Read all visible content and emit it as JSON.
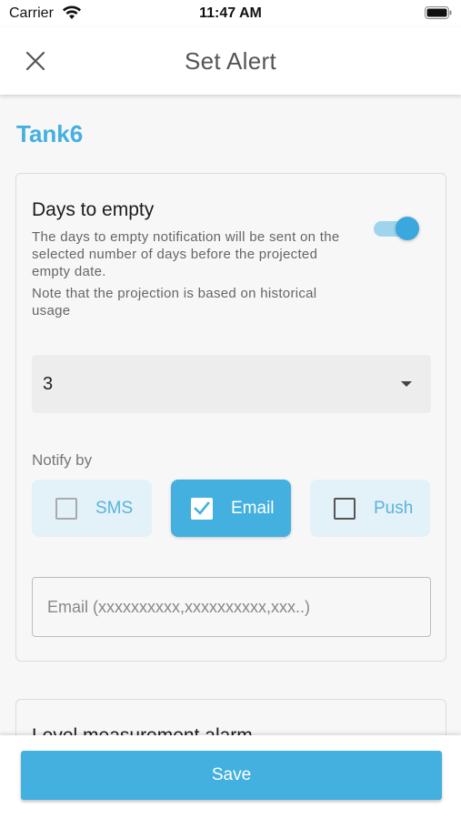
{
  "status_bar": {
    "carrier": "Carrier",
    "time": "11:47 AM",
    "wifi_icon": "wifi-icon",
    "battery_icon": "battery-icon"
  },
  "nav": {
    "title": "Set Alert",
    "close_icon": "close-icon"
  },
  "tank": {
    "name": "Tank6"
  },
  "days_to_empty": {
    "title": "Days to empty",
    "description": "The days to empty notification will be sent on the selected number of days before the projected empty date.",
    "note": "Note that the projection is based on historical usage",
    "enabled": true,
    "selected_days": "3",
    "notify_label": "Notify by",
    "notify_options": [
      {
        "label": "SMS",
        "checked": false
      },
      {
        "label": "Email",
        "checked": true
      },
      {
        "label": "Push",
        "checked": false
      }
    ],
    "email_value": "",
    "email_placeholder": "Email (xxxxxxxxxx,xxxxxxxxxx,xxx..)"
  },
  "level_alarm": {
    "title": "Level measurement alarm"
  },
  "footer": {
    "save_label": "Save"
  },
  "colors": {
    "accent": "#44b0e0",
    "chip_bg": "#e3f1f9",
    "toggle_track": "#9fd4ee"
  }
}
